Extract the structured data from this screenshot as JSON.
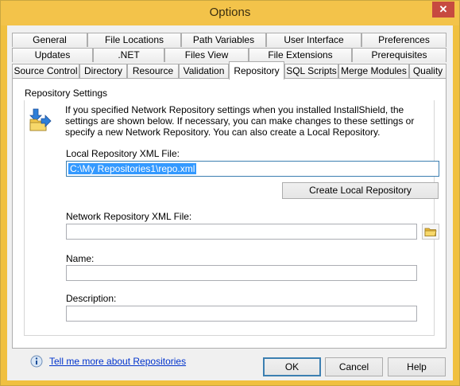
{
  "window": {
    "title": "Options",
    "close_glyph": "✕"
  },
  "tabs": {
    "row1": [
      "General",
      "File Locations",
      "Path Variables",
      "User Interface",
      "Preferences"
    ],
    "row2": [
      "Updates",
      ".NET",
      "Files View",
      "File Extensions",
      "Prerequisites"
    ],
    "row3": [
      "Source Control",
      "Directory",
      "Resource",
      "Validation",
      "Repository",
      "SQL Scripts",
      "Merge Modules",
      "Quality"
    ],
    "active": "Repository"
  },
  "repository": {
    "group_title": "Repository Settings",
    "info_text": "If you specified Network Repository settings when you installed InstallShield, the settings are shown below. If necessary, you can make changes to these settings or specify a new Network Repository.  You can also create a Local Repository.",
    "local_label": "Local Repository XML File:",
    "local_value": "C:\\My Repositories1\\repo.xml",
    "create_button": "Create Local Repository",
    "network_label": "Network Repository XML File:",
    "network_value": "",
    "name_label": "Name:",
    "name_value": "",
    "description_label": "Description:",
    "description_value": "",
    "help_link": "Tell me more about Repositories"
  },
  "buttons": {
    "ok": "OK",
    "cancel": "Cancel",
    "help": "Help"
  },
  "icons": {
    "repository": "repository-transfer-icon",
    "browse": "folder-icon",
    "info": "info-icon"
  },
  "colors": {
    "titlebar": "#f3c34a",
    "close": "#c74a40",
    "selection": "#3399ff",
    "link": "#0033cc"
  }
}
